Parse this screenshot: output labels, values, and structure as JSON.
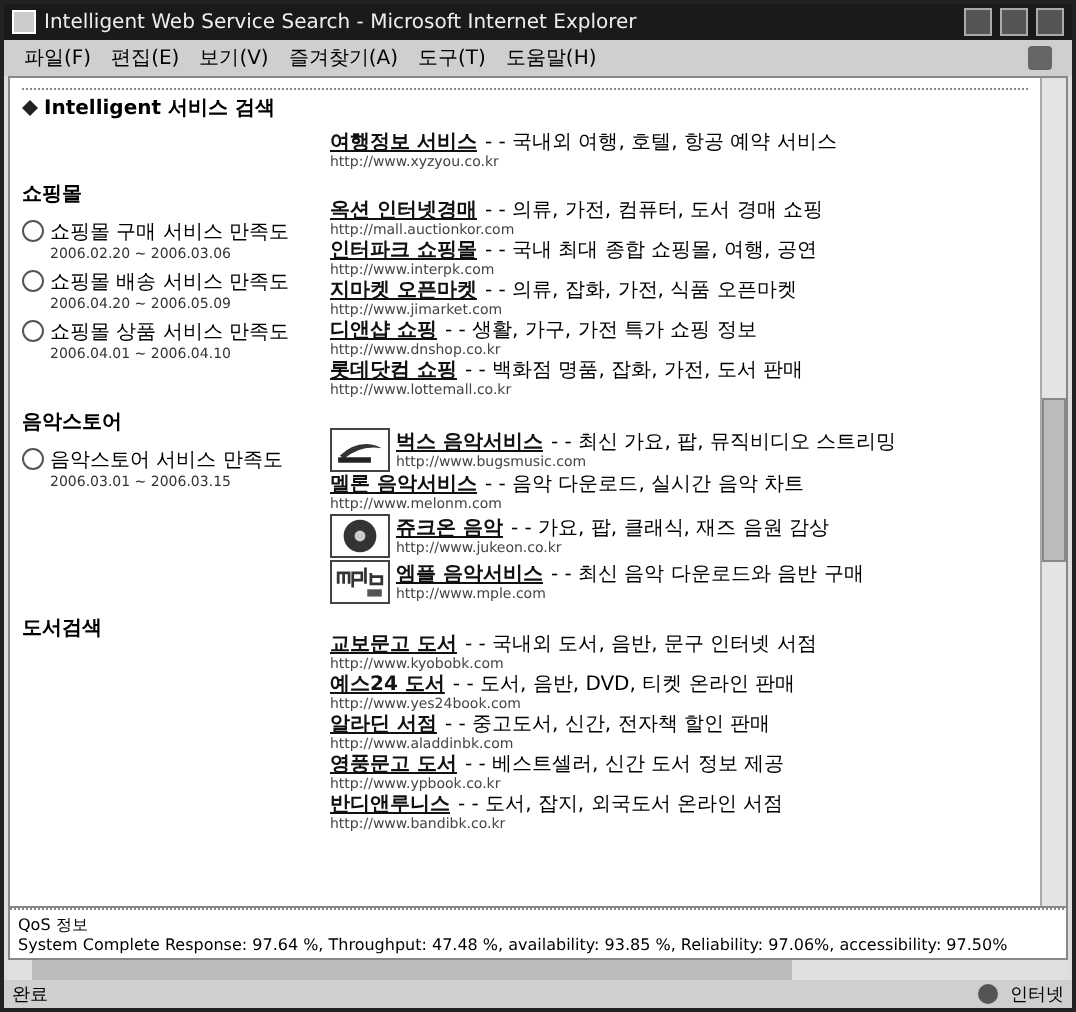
{
  "window": {
    "title": "Intelligent Web Service Search - Microsoft Internet Explorer"
  },
  "menu": [
    "파일(F)",
    "편집(E)",
    "보기(V)",
    "즐겨찾기(A)",
    "도구(T)",
    "도움말(H)"
  ],
  "page": {
    "heading": "Intelligent 서비스 검색",
    "featured": {
      "title": "여행정보 서비스",
      "desc": "- - 국내외 여행, 호텔, 항공 예약 서비스",
      "url": "http://www.xyzyou.co.kr"
    },
    "sections": [
      {
        "name": "쇼핑몰",
        "options": [
          {
            "label": "쇼핑몰 구매 서비스 만족도",
            "dates": "2006.02.20 ~ 2006.03.06",
            "selected": false
          },
          {
            "label": "쇼핑몰 배송 서비스 만족도",
            "dates": "2006.04.20 ~ 2006.05.09",
            "selected": false
          },
          {
            "label": "쇼핑몰 상품 서비스 만족도",
            "dates": "2006.04.01 ~ 2006.04.10",
            "selected": false
          }
        ],
        "results": [
          {
            "kind": "text",
            "title": "옥션 인터넷경매",
            "desc": "- - 의류, 가전, 컴퓨터, 도서 경매 쇼핑",
            "url": "http://mall.auctionkor.com"
          },
          {
            "kind": "text",
            "title": "인터파크 쇼핑몰",
            "desc": "- - 국내 최대 종합 쇼핑몰, 여행, 공연",
            "url": "http://www.interpk.com"
          },
          {
            "kind": "text",
            "title": "지마켓 오픈마켓",
            "desc": "- - 의류, 잡화, 가전, 식품 오픈마켓",
            "url": "http://www.jimarket.com"
          },
          {
            "kind": "text",
            "title": "디앤샵 쇼핑",
            "desc": "- - 생활, 가구, 가전 특가 쇼핑 정보",
            "url": "http://www.dnshop.co.kr"
          },
          {
            "kind": "text",
            "title": "롯데닷컴 쇼핑",
            "desc": "- - 백화점 명품, 잡화, 가전, 도서 판매",
            "url": "http://www.lottemall.co.kr"
          }
        ]
      },
      {
        "name": "음악스토어",
        "options": [
          {
            "label": "음악스토어 서비스 만족도",
            "dates": "2006.03.01 ~ 2006.03.15",
            "selected": false
          }
        ],
        "results": [
          {
            "kind": "swoosh",
            "title": "벅스 음악서비스",
            "desc": "- - 최신 가요, 팝, 뮤직비디오 스트리밍",
            "url": "http://www.bugsmusic.com"
          },
          {
            "kind": "text",
            "title": "멜론 음악서비스",
            "desc": "- - 음악 다운로드, 실시간 음악 차트",
            "url": "http://www.melonm.com"
          },
          {
            "kind": "disc",
            "title": "쥬크온 음악",
            "desc": "- - 가요, 팝, 클래식, 재즈 음원 감상",
            "url": "http://www.jukeon.co.kr"
          },
          {
            "kind": "letters",
            "title": "엠플 음악서비스",
            "desc": "- - 최신 음악 다운로드와 음반 구매",
            "url": "http://www.mple.com"
          }
        ]
      },
      {
        "name": "도서검색",
        "results": [
          {
            "kind": "text",
            "title": "교보문고 도서",
            "desc": "- - 국내외 도서, 음반, 문구 인터넷 서점",
            "url": "http://www.kyobobk.com"
          },
          {
            "kind": "text",
            "title": "예스24 도서",
            "desc": "- - 도서, 음반, DVD, 티켓 온라인 판매",
            "url": "http://www.yes24book.com"
          },
          {
            "kind": "text",
            "title": "알라딘 서점",
            "desc": "- - 중고도서, 신간, 전자책 할인 판매",
            "url": "http://www.aladdinbk.com"
          },
          {
            "kind": "text",
            "title": "영풍문고 도서",
            "desc": "- - 베스트셀러, 신간 도서 정보 제공",
            "url": "http://www.ypbook.co.kr"
          },
          {
            "kind": "text",
            "title": "반디앤루니스",
            "desc": "- - 도서, 잡지, 외국도서 온라인 서점",
            "url": "http://www.bandibk.co.kr"
          }
        ]
      }
    ]
  },
  "qos": {
    "label": "QoS 정보",
    "text": "System Complete Response: 97.64 %, Throughput: 47.48 %, availability: 93.85 %, Reliability: 97.06%, accessibility: 97.50%"
  },
  "status_bar": {
    "text": "완료",
    "zone": "인터넷"
  }
}
